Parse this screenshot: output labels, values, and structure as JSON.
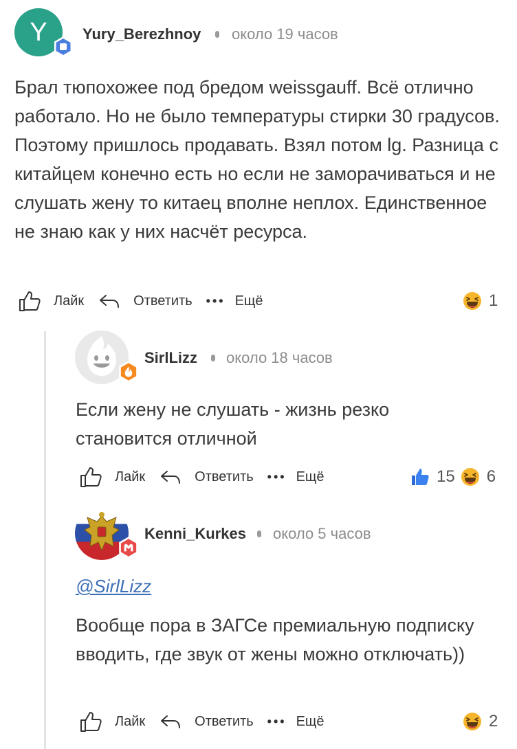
{
  "comments": [
    {
      "avatar_letter": "Y",
      "avatar_color": "#2aa189",
      "badge_color": "#4a7fe0",
      "username": "Yury_Berezhnoy",
      "time": "около 19 часов",
      "text": "Брал тюпохожее под бредом weissgauff. Всё отлично работало. Но не было температуры стирки 30 градусов. Поэтому пришлось продавать. Взял потом lg. Разница с китайцем конечно есть но если не заморачиваться и не слушать жену то китаец вполне неплох. Единственное не знаю как у них насчёт ресурса.",
      "like_label": "Лайк",
      "reply_label": "Ответить",
      "more_label": "Ещё",
      "reactions": [
        {
          "icon": "laughing-emoji",
          "count": "1"
        }
      ]
    },
    {
      "username": "SirlLizz",
      "badge_color": "#f58a1f",
      "time": "около 18 часов",
      "text": "Если жену не слушать - жизнь резко становится отличной",
      "like_label": "Лайк",
      "reply_label": "Ответить",
      "more_label": "Ещё",
      "reactions": [
        {
          "icon": "thumbs-up",
          "count": "15"
        },
        {
          "icon": "laughing-emoji",
          "count": "6"
        }
      ]
    },
    {
      "username": "Kenni_Kurkes",
      "badge_color": "#e84a4a",
      "time": "около 5 часов",
      "mention": "@SirlLizz",
      "text": "Вообще пора в ЗАГСе премиальную подписку вводить, где звук от жены можно отключать))",
      "like_label": "Лайк",
      "reply_label": "Ответить",
      "more_label": "Ещё",
      "reactions": [
        {
          "icon": "laughing-emoji",
          "count": "2"
        }
      ]
    }
  ],
  "colors": {
    "text": "#3a3a3a",
    "meta": "#8c8c8c",
    "link": "#3d6fb6",
    "emoji": "#f7b52c"
  }
}
